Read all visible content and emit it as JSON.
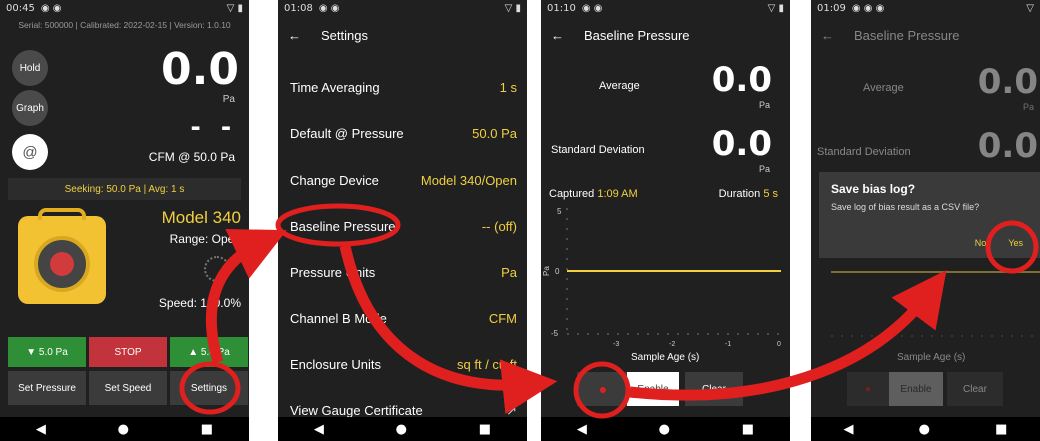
{
  "nav": {
    "back": "◀",
    "home": "●",
    "recent": "■"
  },
  "screen1": {
    "time": "00:45",
    "info": "Serial: 500000  |  Calibrated: 2022-02-15  |  Version: 1.0.10",
    "hold": "Hold",
    "graph": "Graph",
    "at": "@",
    "pressure_value": "0.0",
    "pressure_unit": "Pa",
    "flow_value": "- -",
    "cfm_label": "CFM @ 50.0 Pa",
    "seeking": "Seeking: 50.0 Pa  |  Avg: 1 s",
    "model": "Model 340",
    "range": "Range: Open",
    "speed": "Speed: 100.0%",
    "btn_down": "▼ 5.0 Pa",
    "btn_stop": "STOP",
    "btn_up": "▲ 5.0 Pa",
    "btn_set_pressure": "Set Pressure",
    "btn_set_speed": "Set Speed",
    "btn_settings": "Settings"
  },
  "screen2": {
    "time": "01:08",
    "title": "Settings",
    "rows": [
      {
        "label": "Time Averaging",
        "value": "1 s"
      },
      {
        "label": "Default @ Pressure",
        "value": "50.0 Pa"
      },
      {
        "label": "Change Device",
        "value": "Model 340/Open"
      },
      {
        "label": "Baseline Pressure",
        "value": "-- (off)"
      },
      {
        "label": "Pressure Units",
        "value": "Pa"
      },
      {
        "label": "Channel B Mode",
        "value": "CFM"
      },
      {
        "label": "Enclosure Units",
        "value": "sq ft / cu ft"
      },
      {
        "label": "View Gauge Certificate",
        "value": "↗"
      }
    ]
  },
  "screen3": {
    "time": "01:10",
    "title": "Baseline Pressure",
    "average_label": "Average",
    "average_value": "0.0",
    "sd_label": "Standard Deviation",
    "sd_value": "0.0",
    "unit": "Pa",
    "captured_label": "Captured",
    "captured_value": "1:09 AM",
    "duration_label": "Duration",
    "duration_value": "5 s",
    "y_axis_label": "Pa",
    "y_top": "5",
    "y_mid": "0",
    "y_bottom": "-5",
    "x_ticks": [
      "-3",
      "-2",
      "-1",
      "0"
    ],
    "x_axis_label": "Sample Age (s)",
    "btn_enable": "Enable",
    "btn_clear": "Clear"
  },
  "screen4": {
    "time": "01:09",
    "title": "Baseline Pressure",
    "average_label": "Average",
    "average_value": "0.0",
    "sd_label": "Standard Deviation",
    "sd_value": "0.0",
    "unit": "Pa",
    "x_axis_label": "Sample Age (s)",
    "btn_enable": "Enable",
    "btn_clear": "Clear",
    "dialog_title": "Save bias log?",
    "dialog_text": "Save log of bias result as a CSV file?",
    "dialog_no": "No",
    "dialog_yes": "Yes"
  }
}
